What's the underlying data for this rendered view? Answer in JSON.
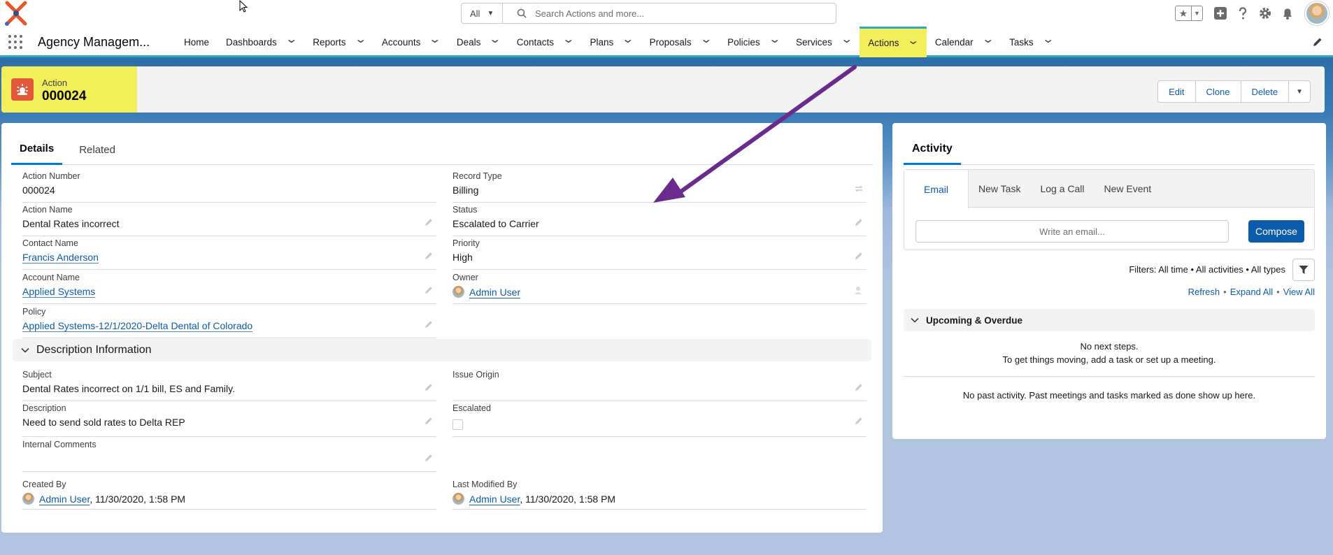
{
  "topbar": {
    "search_scope": "All",
    "search_placeholder": "Search Actions and more..."
  },
  "nav": {
    "app_name": "Agency Managem...",
    "items": [
      {
        "label": "Home",
        "has_menu": false
      },
      {
        "label": "Dashboards",
        "has_menu": true
      },
      {
        "label": "Reports",
        "has_menu": true
      },
      {
        "label": "Accounts",
        "has_menu": true
      },
      {
        "label": "Deals",
        "has_menu": true
      },
      {
        "label": "Contacts",
        "has_menu": true
      },
      {
        "label": "Plans",
        "has_menu": true
      },
      {
        "label": "Proposals",
        "has_menu": true
      },
      {
        "label": "Policies",
        "has_menu": true
      },
      {
        "label": "Services",
        "has_menu": true
      },
      {
        "label": "Actions",
        "has_menu": true,
        "active": true
      },
      {
        "label": "Calendar",
        "has_menu": true
      },
      {
        "label": "Tasks",
        "has_menu": true
      }
    ]
  },
  "header": {
    "object_type": "Action",
    "record_name": "000024",
    "buttons": {
      "edit": "Edit",
      "clone": "Clone",
      "delete": "Delete"
    }
  },
  "tabs": {
    "details": "Details",
    "related": "Related"
  },
  "fields": {
    "action_number": {
      "label": "Action Number",
      "value": "000024"
    },
    "record_type": {
      "label": "Record Type",
      "value": "Billing"
    },
    "action_name": {
      "label": "Action Name",
      "value": "Dental Rates incorrect"
    },
    "status": {
      "label": "Status",
      "value": "Escalated to Carrier"
    },
    "contact_name": {
      "label": "Contact Name",
      "value": "Francis Anderson"
    },
    "priority": {
      "label": "Priority",
      "value": "High"
    },
    "account_name": {
      "label": "Account Name",
      "value": "Applied Systems"
    },
    "owner": {
      "label": "Owner",
      "value": "Admin User"
    },
    "policy": {
      "label": "Policy",
      "value": "Applied Systems-12/1/2020-Delta Dental of Colorado"
    },
    "subject": {
      "label": "Subject",
      "value": "Dental Rates incorrect on 1/1 bill, ES and Family."
    },
    "issue_origin": {
      "label": "Issue Origin",
      "value": ""
    },
    "description": {
      "label": "Description",
      "value": "Need to send sold rates to Delta REP"
    },
    "escalated": {
      "label": "Escalated",
      "checked": false
    },
    "internal_comments": {
      "label": "Internal Comments",
      "value": ""
    },
    "created_by": {
      "label": "Created By",
      "user": "Admin User",
      "date": ", 11/30/2020, 1:58 PM"
    },
    "last_modified_by": {
      "label": "Last Modified By",
      "user": "Admin User",
      "date": ", 11/30/2020, 1:58 PM"
    }
  },
  "section": {
    "description_info": "Description Information"
  },
  "activity": {
    "tab": "Activity",
    "composer_tabs": [
      "Email",
      "New Task",
      "Log a Call",
      "New Event"
    ],
    "email_placeholder": "Write an email...",
    "compose_label": "Compose",
    "filters": "Filters: All time • All activities • All types",
    "links": {
      "refresh": "Refresh",
      "expand_all": "Expand All",
      "view_all": "View All"
    },
    "upcoming_title": "Upcoming & Overdue",
    "no_steps_line1": "No next steps.",
    "no_steps_line2": "To get things moving, add a task or set up a meeting.",
    "no_past": "No past activity. Past meetings and tasks marked as done show up here."
  },
  "colors": {
    "brand_blue": "#0b5cab",
    "highlight_yellow": "#f3ef5b",
    "action_icon": "#e3573c",
    "annotation_arrow": "#6a2a8e"
  }
}
